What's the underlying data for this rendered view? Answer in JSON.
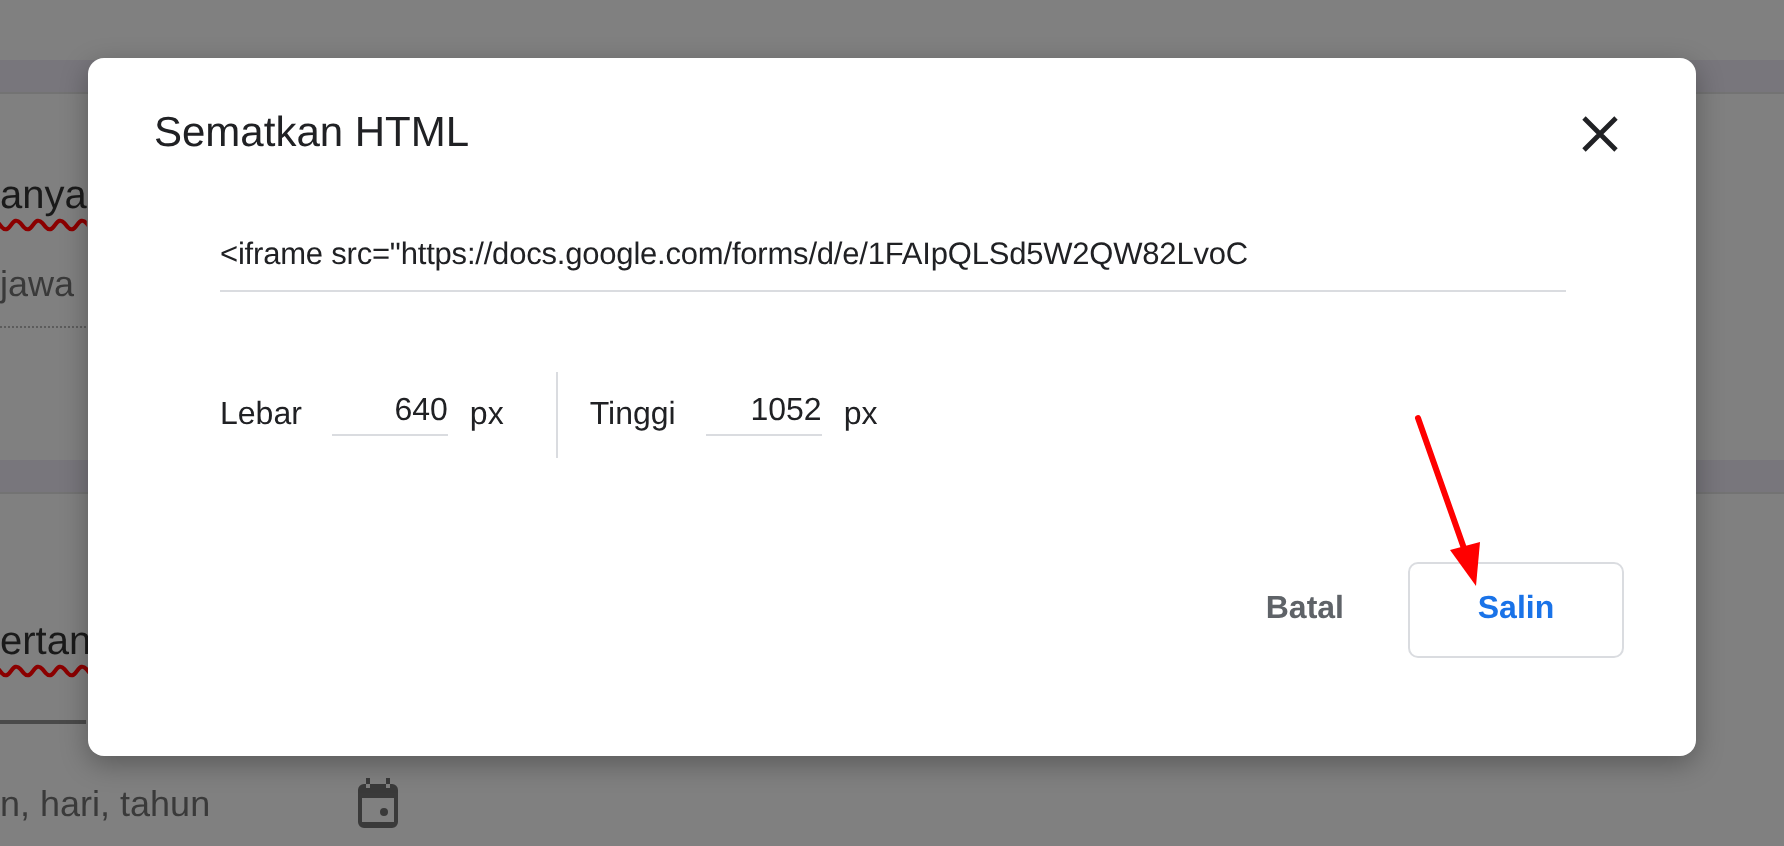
{
  "background_form": {
    "cards": [
      {
        "title_fragment": "anya",
        "hint_fragment": "jawa",
        "kind": "text"
      },
      {
        "title_fragment": "ertan",
        "hint_fragment": "n, hari, tahun",
        "kind": "date"
      }
    ]
  },
  "dialog": {
    "title": "Sematkan HTML",
    "embed_code": "<iframe src=\"https://docs.google.com/forms/d/e/1FAIpQLSd5W2QW82LvoC",
    "size_fields": [
      {
        "label": "Lebar",
        "value": "640",
        "unit": "px"
      },
      {
        "label": "Tinggi",
        "value": "1052",
        "unit": "px"
      }
    ],
    "buttons": [
      {
        "label": "Batal",
        "kind": "text"
      },
      {
        "label": "Salin",
        "kind": "outlined"
      }
    ]
  }
}
